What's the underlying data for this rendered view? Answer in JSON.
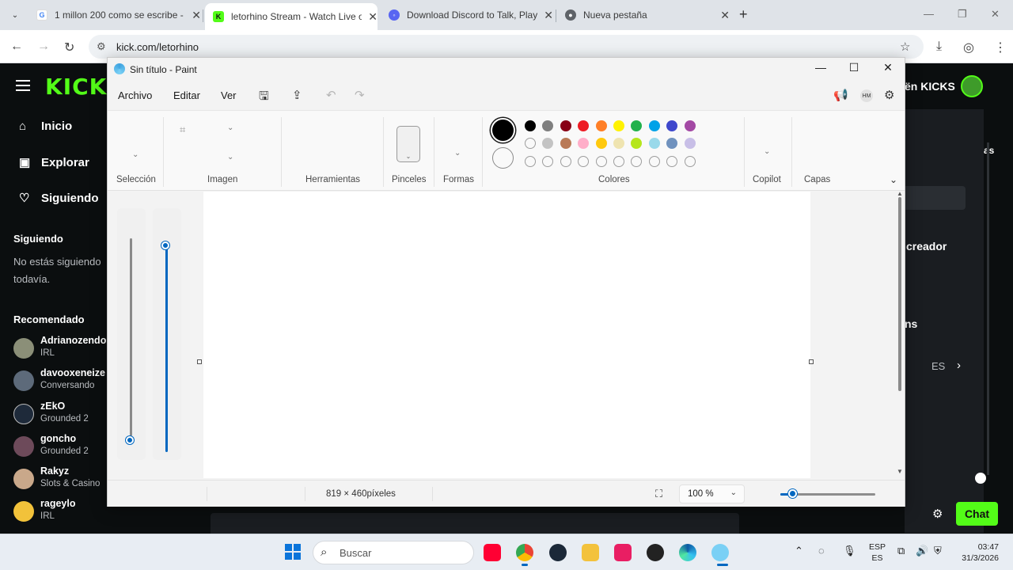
{
  "browser": {
    "tabs": [
      {
        "title": "1 millon 200 como se escribe -",
        "active": false
      },
      {
        "title": "letorhino Stream - Watch Live o",
        "active": true
      },
      {
        "title": "Download Discord to Talk, Play",
        "active": false
      },
      {
        "title": "Nueva pestaña",
        "active": false
      }
    ],
    "url": "kick.com/letorhino"
  },
  "kick": {
    "logo": "KICK",
    "nav": [
      "Inicio",
      "Explorar",
      "Siguiendo"
    ],
    "following_heading": "Siguiendo",
    "following_empty": "No estás siguiendo",
    "following_empty2": "todavía.",
    "recommended_heading": "Recomendado",
    "recommended": [
      {
        "name": "Adrianozendo",
        "category": "IRL",
        "color": "#8b8f78"
      },
      {
        "name": "davooxeneize",
        "category": "Conversando",
        "color": "#5d6a7a"
      },
      {
        "name": "zEkO",
        "category": "Grounded 2",
        "color": "#1e2a3a"
      },
      {
        "name": "goncho",
        "category": "Grounded 2",
        "color": "#6d4a5a"
      },
      {
        "name": "Rakyz",
        "category": "Slots & Casino",
        "color": "#c9a88a"
      },
      {
        "name": "rageylo",
        "category": "IRL",
        "color": "#f2c23a"
      }
    ],
    "right_kicks": "ën KICKS",
    "right_creador": "creador",
    "right_fragment": "as",
    "right_fragment2": "ns",
    "lang": "ES",
    "chat_button": "Chat"
  },
  "paint": {
    "title": "Sin título - Paint",
    "menu": [
      "Archivo",
      "Editar",
      "Ver"
    ],
    "ribbon_labels": {
      "selection": "Selección",
      "image": "Imagen",
      "tools": "Herramientas",
      "brushes": "Pinceles",
      "shapes": "Formas",
      "colors": "Colores",
      "copilot": "Copilot",
      "layers": "Capas"
    },
    "avatar_initials": "HM",
    "primary_color": "#000000",
    "secondary_color": "#ffffff",
    "palette_row1": [
      "#000000",
      "#7f7f7f",
      "#880015",
      "#ed1c24",
      "#ff7f27",
      "#fff200",
      "#22b14c",
      "#00a2e8",
      "#3f48cc",
      "#a349a4"
    ],
    "palette_row2": [
      "#ffffff",
      "#c3c3c3",
      "#b97a57",
      "#ffaec9",
      "#ffc90e",
      "#efe4b0",
      "#b5e61d",
      "#99d9ea",
      "#7092be",
      "#c8bfe7"
    ],
    "palette_row3_empty": 10,
    "canvas_size": "819 × 460píxeles",
    "zoom": "100 %"
  },
  "taskbar": {
    "search_placeholder": "Buscar",
    "lang_top": "ESP",
    "lang_bottom": "ES",
    "time": "03:47",
    "date": "31/3/2026"
  }
}
